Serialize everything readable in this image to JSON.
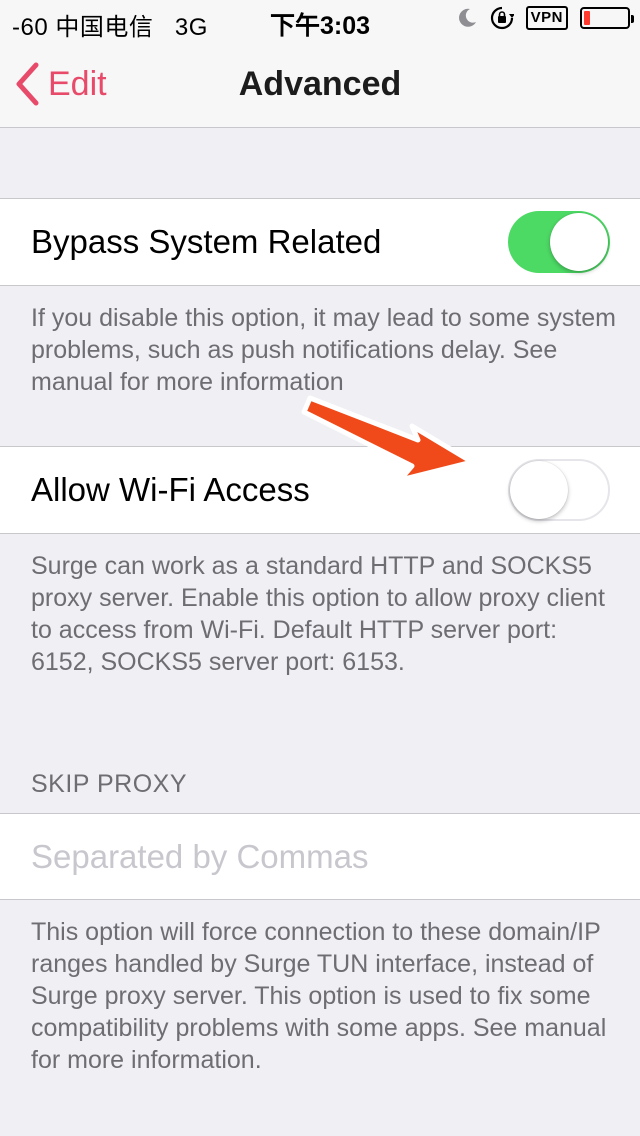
{
  "status_bar": {
    "carrier": "-60 中国电信",
    "network": "3G",
    "time": "下午3:03",
    "vpn_label": "VPN",
    "battery_level": 0.15,
    "icons": [
      "moon-icon",
      "rotation-lock-icon",
      "battery-icon"
    ]
  },
  "nav": {
    "back_label": "Edit",
    "title": "Advanced",
    "accent_color": "#e84a6a"
  },
  "settings": {
    "bypass": {
      "label": "Bypass System Related",
      "enabled": true,
      "footer": "If you disable this option, it may lead to some system problems, such as push notifications delay. See manual for more information"
    },
    "wifi_access": {
      "label": "Allow Wi-Fi Access",
      "enabled": false,
      "footer": "Surge can work as a standard HTTP and SOCKS5 proxy server. Enable this option to allow proxy client to access from Wi-Fi. Default HTTP server port: 6152, SOCKS5 server port: 6153."
    },
    "skip_proxy": {
      "header": "SKIP PROXY",
      "value": "",
      "placeholder": "Separated by Commas",
      "footer": "This option will force connection to these domain/IP ranges handled by Surge TUN interface, instead of Surge proxy server. This option is used to fix some compatibility problems with some apps. See manual for more information."
    }
  },
  "colors": {
    "toggle_on": "#4cd964",
    "annotation_arrow": "#f04a1a"
  }
}
